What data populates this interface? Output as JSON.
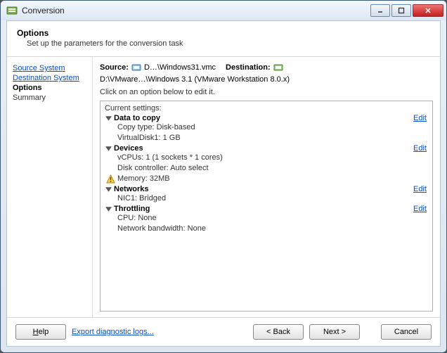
{
  "window": {
    "title": "Conversion"
  },
  "header": {
    "title": "Options",
    "subtitle": "Set up the parameters for the conversion task"
  },
  "sidebar": {
    "items": [
      {
        "label": "Source System",
        "kind": "link"
      },
      {
        "label": "Destination System",
        "kind": "link"
      },
      {
        "label": "Options",
        "kind": "current"
      },
      {
        "label": "Summary",
        "kind": "plain"
      }
    ]
  },
  "sourcebar": {
    "source_label": "Source:",
    "source_value": "D…\\Windows31.vmc",
    "dest_label": "Destination:",
    "dest_value": "D:\\VMware…\\Windows 3.1 (VMware Workstation 8.0.x)"
  },
  "hint": "Click on an option below to edit it.",
  "settings": {
    "current_label": "Current settings:",
    "edit_label": "Edit",
    "groups": [
      {
        "name": "Data to copy",
        "items": [
          "Copy type: Disk-based",
          "VirtualDisk1: 1 GB"
        ]
      },
      {
        "name": "Devices",
        "items": [
          "vCPUs: 1 (1 sockets * 1 cores)",
          "Disk controller: Auto select"
        ],
        "warn_items": [
          "Memory: 32MB"
        ]
      },
      {
        "name": "Networks",
        "items": [
          "NIC1: Bridged"
        ]
      },
      {
        "name": "Throttling",
        "items": [
          "CPU: None",
          "Network bandwidth: None"
        ]
      }
    ]
  },
  "footer": {
    "help": "Help",
    "diag": "Export diagnostic logs...",
    "back": "< Back",
    "next": "Next >",
    "cancel": "Cancel"
  },
  "colors": {
    "link": "#0b4fc7"
  }
}
